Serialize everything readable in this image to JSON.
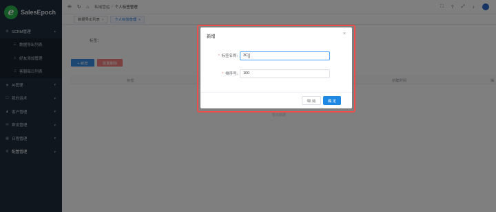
{
  "app": {
    "logo_mark": "e",
    "name": "SalesEpoch"
  },
  "sidebar": {
    "items": [
      {
        "label": "SCRM管理",
        "icon": "gear-icon",
        "glyph": "⚙",
        "chevron": "▲"
      },
      {
        "label": "数据导出列表",
        "icon": "list-icon",
        "glyph": "☰"
      },
      {
        "label": "好友添加管理",
        "icon": "user-icon",
        "glyph": "♙"
      },
      {
        "label": "客服每日列表",
        "icon": "chat-icon",
        "glyph": "☷"
      },
      {
        "label": "AI管理",
        "icon": "ai-icon",
        "glyph": "◈",
        "chevron": "▼"
      },
      {
        "label": "我的话术",
        "icon": "script-icon",
        "glyph": "☐",
        "chevron": "▼"
      },
      {
        "label": "客户管理",
        "icon": "customer-icon",
        "glyph": "♟",
        "chevron": "▼"
      },
      {
        "label": "群发管理",
        "icon": "broadcast-icon",
        "glyph": "✉",
        "chevron": "▼"
      },
      {
        "label": "日程管理",
        "icon": "calendar-icon",
        "glyph": "▦",
        "chevron": "▼"
      },
      {
        "label": "配置管理",
        "icon": "config-icon",
        "glyph": "⚙",
        "chevron": "▼"
      }
    ]
  },
  "header": {
    "breadcrumbs": [
      "私域营运",
      "个人标签管理"
    ],
    "sep": "/",
    "home_glyph": "⌂",
    "icons": {
      "menu": "☰",
      "refresh": "↻",
      "fullscreen": "⛶",
      "help": "?",
      "expand": "⤢",
      "bell": "♪"
    }
  },
  "tabs": [
    {
      "label": "数据导出列表",
      "close": "×"
    },
    {
      "label": "个人标签管理",
      "close": "×"
    }
  ],
  "main": {
    "search_label": "标签：",
    "add_label": "+ 新增",
    "delete_label": "批量删除",
    "columns": [
      "标签",
      "创建时间",
      "操"
    ],
    "empty_text": "暂无数据"
  },
  "dialog": {
    "title": "新增",
    "close_glyph": "×",
    "fields": [
      {
        "required": "*",
        "label": "标签名称:",
        "value": "3C"
      },
      {
        "required": "*",
        "label": "排序号:",
        "value": "100"
      }
    ],
    "cancel_label": "取 消",
    "ok_label": "确 定"
  },
  "colors": {
    "sidebar_bg": "#1f2d3d",
    "primary": "#1e88e5",
    "danger": "#f56c6c",
    "highlight": "#e8504c"
  }
}
